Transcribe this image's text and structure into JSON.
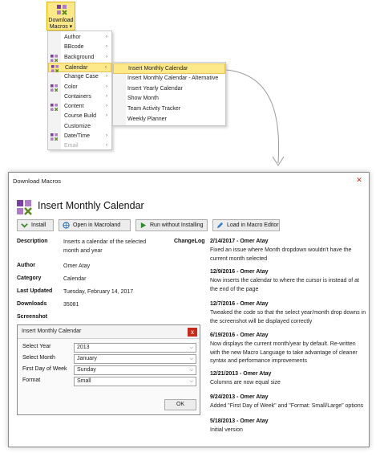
{
  "ribbon": {
    "label_line1": "Download",
    "label_line2": "Macros ▾"
  },
  "main_menu": {
    "items": [
      {
        "label": "Author",
        "icon": "none"
      },
      {
        "label": "BBcode",
        "icon": "none"
      },
      {
        "label": "Background",
        "icon": "macro-icon"
      },
      {
        "label": "Calendar",
        "icon": "macro-icon"
      },
      {
        "label": "Change Case",
        "icon": "none"
      },
      {
        "label": "Color",
        "icon": "macro-icon"
      },
      {
        "label": "Containers",
        "icon": "none"
      },
      {
        "label": "Content",
        "icon": "macro-icon"
      },
      {
        "label": "Course Build",
        "icon": "none"
      },
      {
        "label": "Customize",
        "icon": "none"
      },
      {
        "label": "Date/Time",
        "icon": "macro-icon"
      },
      {
        "label": "Email",
        "icon": "none"
      }
    ],
    "arrow": "›"
  },
  "sub_menu": {
    "items": [
      "Insert Monthly Calendar",
      "Insert Monthly Calendar - Alternative",
      "Insert Yearly Calendar",
      "Show Month",
      "Team Activity Tracker",
      "Weekly Planner"
    ]
  },
  "dialog": {
    "title": "Download Macros",
    "close": "✕",
    "header": "Insert Monthly Calendar",
    "buttons": {
      "install": "Install",
      "open": "Open in Macroland",
      "run": "Run without Installing",
      "load": "Load in Macro Editor"
    },
    "fields": {
      "description_label": "Description",
      "description_value": "Inserts a calendar of the selected month and year",
      "author_label": "Author",
      "author_value": "Omer Atay",
      "category_label": "Category",
      "category_value": "Calendar",
      "updated_label": "Last Updated",
      "updated_value": "Tuesday, February 14, 2017",
      "downloads_label": "Downloads",
      "downloads_value": "35081",
      "screenshot_label": "Screenshot"
    },
    "changelog_label": "ChangeLog",
    "changelog": [
      {
        "head": "2/14/2017 - Omer Atay",
        "text": "Fixed an issue where Month dropdown wouldn't have the current month selected"
      },
      {
        "head": "12/9/2016 - Omer Atay",
        "text": "Now inserts the calendar to where the cursor is instead of at the end of the page"
      },
      {
        "head": "12/7/2016 - Omer Atay",
        "text": "Tweaked the code so that the select year/month drop downs in the screenshot will be displayed correctly"
      },
      {
        "head": "6/19/2016 - Omer Atay",
        "text": "Now displays the current month/year by default. Re-written with the new Macro Language to take advantage of cleaner syntax and performance improvements"
      },
      {
        "head": "12/21/2013 - Omer Atay",
        "text": "Columns are now equal size"
      },
      {
        "head": "9/24/2013 - Omer Atay",
        "text": "Added \"First Day of Week\" and \"Format: Small/Large\" options"
      },
      {
        "head": "5/18/2013 - Omer Atay",
        "text": "Initial version"
      }
    ]
  },
  "screenshot": {
    "title": "Insert Monthly Calendar",
    "close": "x",
    "rows": [
      {
        "label": "Select Year",
        "value": "2013"
      },
      {
        "label": "Select Month",
        "value": "January"
      },
      {
        "label": "First Day of Week",
        "value": "Sunday"
      },
      {
        "label": "Format",
        "value": "Small"
      }
    ],
    "ok": "OK"
  }
}
